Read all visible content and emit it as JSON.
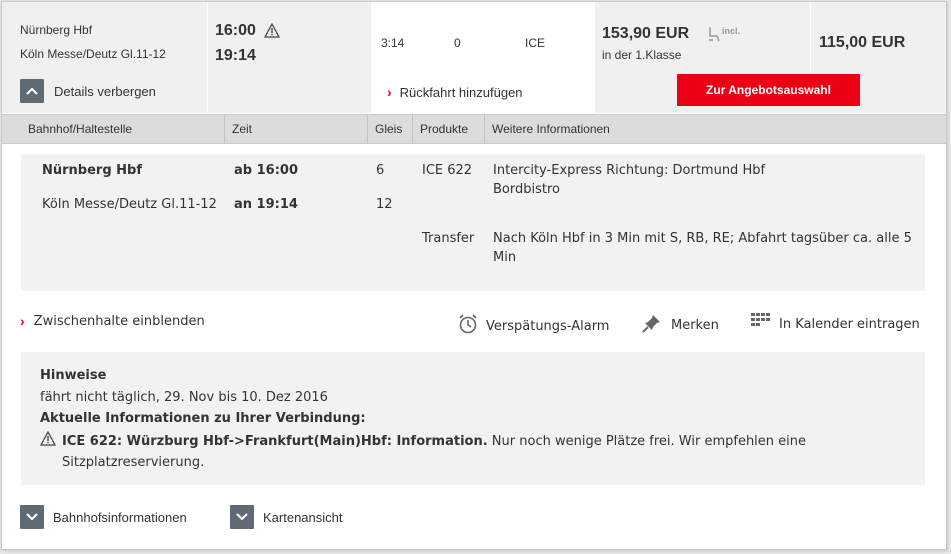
{
  "summary": {
    "from_station": "Nürnberg Hbf",
    "to_station": "Köln Messe/Deutz Gl.11-12",
    "dep_time": "16:00",
    "arr_time": "19:14",
    "duration": "3:14",
    "changes": "0",
    "products": "ICE",
    "price_flex": "153,90 EUR",
    "price_flex_note": "in der 1.Klasse",
    "incl_label": "incl.",
    "price_saver": "115,00 EUR",
    "details_toggle_label": "Details verbergen",
    "return_trip_label": "Rückfahrt hinzufügen",
    "offer_button_label": "Zur Angebotsauswahl"
  },
  "table": {
    "headers": [
      "Bahnhof/Haltestelle",
      "Zeit",
      "Gleis",
      "Produkte",
      "Weitere Informationen"
    ]
  },
  "details": {
    "stop1_name": "Nürnberg Hbf",
    "stop1_time": "ab 16:00",
    "stop1_platform": "6",
    "product": "ICE 622",
    "info_line1": "Intercity-Express Richtung: Dortmund Hbf",
    "info_line2": "Bordbistro",
    "stop2_name": "Köln Messe/Deutz Gl.11-12",
    "stop2_time": "an 19:14",
    "stop2_platform": "12",
    "transfer_label": "Transfer",
    "transfer_line1": "Nach Köln Hbf in 3 Min mit S, RB, RE; Abfahrt tagsüber ca. alle 5",
    "transfer_line2": "Min"
  },
  "actions": {
    "intermediate_stops": "Zwischenhalte einblenden",
    "delay_alarm": "Verspätungs-Alarm",
    "bookmark": "Merken",
    "calendar": "In Kalender eintragen"
  },
  "hints": {
    "title": "Hinweise",
    "line1": "fährt nicht täglich, 29. Nov bis 10. Dez 2016",
    "subtitle": "Aktuelle Informationen zu Ihrer Verbindung:",
    "alert_bold": "ICE 622: Würzburg Hbf->Frankfurt(Main)Hbf: Information.",
    "alert_text": " Nur noch wenige Plätze frei. Wir empfehlen eine",
    "alert_text2": "Sitzplatzreservierung."
  },
  "footer": {
    "station_info": "Bahnhofsinformationen",
    "map_view": "Kartenansicht"
  },
  "colors": {
    "accent_red": "#ec0016",
    "toggle_grey": "#5f6a74"
  }
}
